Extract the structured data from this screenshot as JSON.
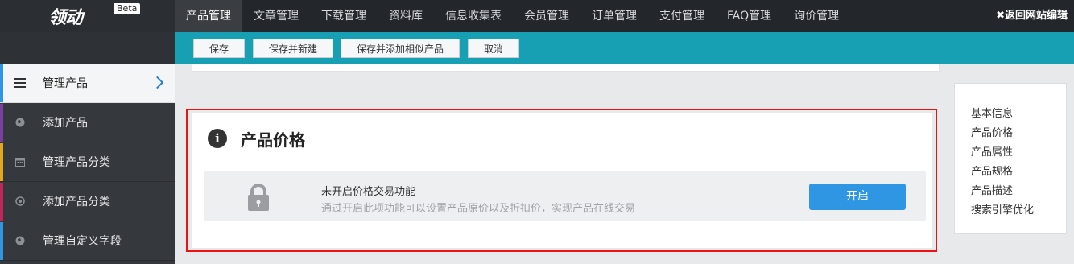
{
  "app": {
    "logo_text": "领动",
    "logo_badge": "Beta",
    "return_link": "✖返回网站编辑"
  },
  "topnav": [
    {
      "label": "产品管理",
      "active": true
    },
    {
      "label": "文章管理"
    },
    {
      "label": "下载管理"
    },
    {
      "label": "资料库"
    },
    {
      "label": "信息收集表"
    },
    {
      "label": "会员管理"
    },
    {
      "label": "订单管理"
    },
    {
      "label": "支付管理"
    },
    {
      "label": "FAQ管理"
    },
    {
      "label": "询价管理"
    }
  ],
  "toolbar": {
    "save": "保存",
    "save_new": "保存并新建",
    "save_add_similar": "保存并添加相似产品",
    "cancel": "取消"
  },
  "sidebar": {
    "items": [
      {
        "label": "管理产品",
        "icon": "list-icon",
        "accent": "#2e96e2",
        "active": true
      },
      {
        "label": "添加产品",
        "icon": "globe-icon",
        "accent": "#7b3fa0"
      },
      {
        "label": "管理产品分类",
        "icon": "calendar-icon",
        "accent": "#e0a81c"
      },
      {
        "label": "添加产品分类",
        "icon": "target-icon",
        "accent": "#c0265a"
      },
      {
        "label": "管理自定义字段",
        "icon": "globe-icon",
        "accent": "#2e96e2"
      }
    ]
  },
  "section": {
    "title": "产品价格",
    "icon": "info-icon",
    "panel_title": "未开启价格交易功能",
    "panel_desc": "通过开启此项功能可以设置产品原价以及折扣价，实现产品在线交易",
    "lock_icon": "lock-icon",
    "enable_button": "开启"
  },
  "anchors": [
    "基本信息",
    "产品价格",
    "产品属性",
    "产品规格",
    "产品描述",
    "搜索引擎优化"
  ],
  "colors": {
    "topbar": "#23262b",
    "toolbar": "#17a0b4",
    "primary_button": "#2e96e2",
    "highlight_border": "#e11111"
  }
}
